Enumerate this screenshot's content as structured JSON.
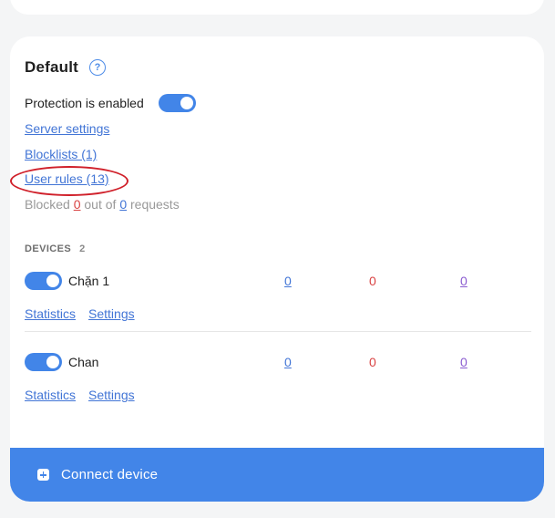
{
  "profile": {
    "title": "Default",
    "help_icon": "question-circle-icon",
    "help_symbol": "?",
    "protection_label": "Protection is enabled",
    "protection_enabled": true,
    "server_settings_link": "Server settings",
    "blocklists_link": "Blocklists (1)",
    "user_rules_link": "User rules (13)",
    "blocked": {
      "prefix": "Blocked",
      "blocked_count": "0",
      "middle": "out of",
      "total_count": "0",
      "suffix": "requests"
    }
  },
  "devices": {
    "header": "DEVICES",
    "count": "2",
    "items": [
      {
        "name": "Chặn 1",
        "enabled": true,
        "stat_1": "0",
        "stat_2": "0",
        "stat_3": "0",
        "statistics_link": "Statistics",
        "settings_link": "Settings"
      },
      {
        "name": "Chan",
        "enabled": true,
        "stat_1": "0",
        "stat_2": "0",
        "stat_3": "0",
        "statistics_link": "Statistics",
        "settings_link": "Settings"
      }
    ]
  },
  "connect": {
    "icon": "plus-square-icon",
    "label": "Connect device"
  },
  "colors": {
    "accent": "#4285e8",
    "link": "#4275d6",
    "blocked_red": "#d94343",
    "annotation_red": "#d0202a",
    "stat_purple": "#8a5bd0"
  }
}
